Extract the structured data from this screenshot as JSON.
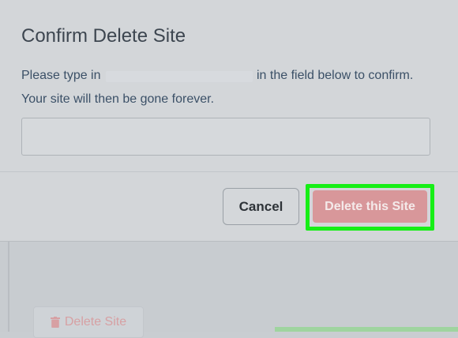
{
  "modal": {
    "title": "Confirm Delete Site",
    "instruction_prefix": "Please type in",
    "instruction_suffix": "in the field below to confirm.",
    "instruction_line2": "Your site will then be gone forever.",
    "confirm_input": {
      "value": "",
      "placeholder": ""
    },
    "cancel_label": "Cancel",
    "delete_label": "Delete this Site"
  },
  "background": {
    "delete_label": "Delete Site"
  },
  "colors": {
    "highlight": "#16ef16",
    "danger": "#d8979a"
  },
  "icons": {
    "background_delete": "trash-icon"
  }
}
